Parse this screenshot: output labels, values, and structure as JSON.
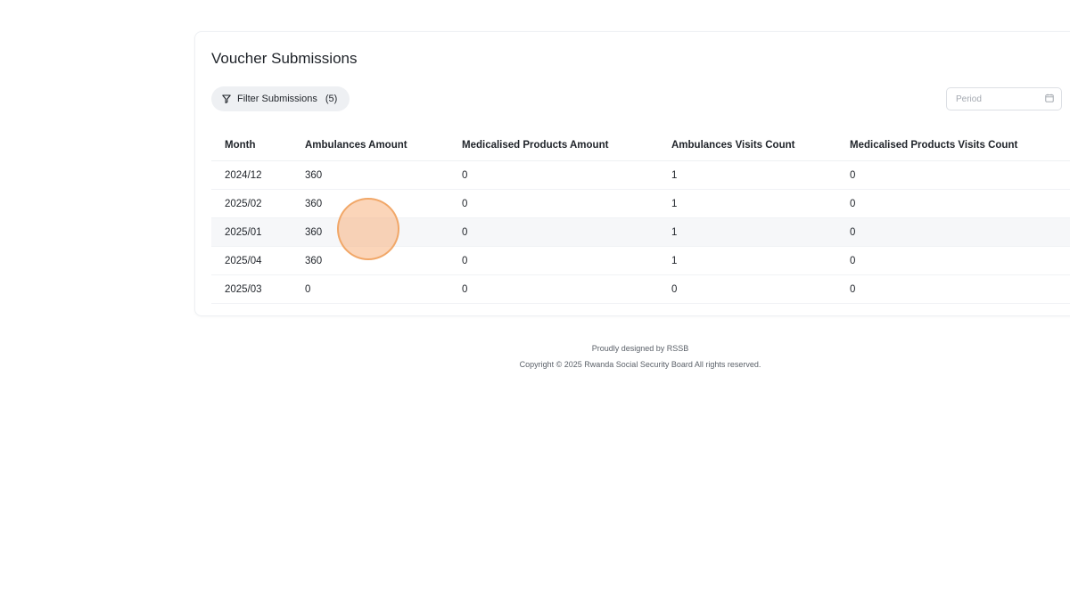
{
  "card": {
    "title": "Voucher Submissions",
    "filter_button": {
      "label": "Filter Submissions",
      "count": "(5)"
    },
    "period": {
      "placeholder": "Period"
    }
  },
  "table": {
    "headers": [
      "Month",
      "Ambulances Amount",
      "Medicalised Products Amount",
      "Ambulances Visits Count",
      "Medicalised Products Visits Count"
    ],
    "rows": [
      [
        "2024/12",
        "360",
        "0",
        "1",
        "0"
      ],
      [
        "2025/02",
        "360",
        "0",
        "1",
        "0"
      ],
      [
        "2025/01",
        "360",
        "0",
        "1",
        "0"
      ],
      [
        "2025/04",
        "360",
        "0",
        "1",
        "0"
      ],
      [
        "2025/03",
        "0",
        "0",
        "0",
        "0"
      ]
    ],
    "hovered_row": 2
  },
  "footer": {
    "line1": "Proudly designed by RSSB",
    "line2": "Copyright © 2025 Rwanda Social Security Board All rights reserved."
  },
  "icons": {
    "filter": "filter-icon",
    "period": "calendar-icon"
  },
  "colors": {
    "cursor_highlight": "#f7b280",
    "row_hover": "#f6f7f9",
    "button_bg": "#eef0f3"
  }
}
